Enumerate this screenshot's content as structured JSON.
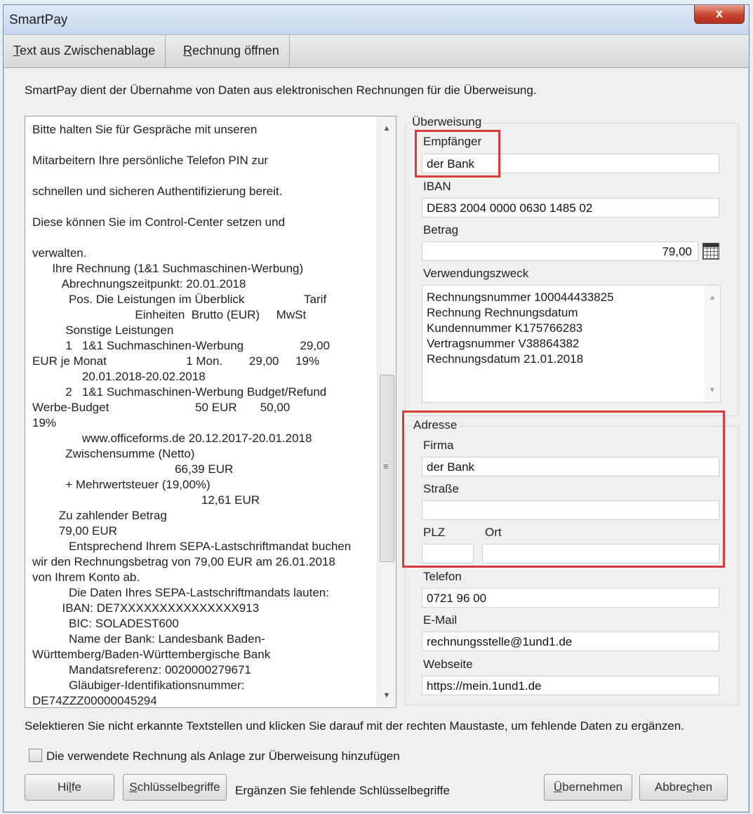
{
  "window": {
    "title": "SmartPay",
    "close_glyph": "x"
  },
  "toolbar": {
    "text_from_clipboard_access": "T",
    "text_from_clipboard_rest": "ext aus Zwischenablage",
    "open_invoice_access": "R",
    "open_invoice_rest": "echnung öffnen"
  },
  "intro": "SmartPay dient der Übernahme von Daten aus elektronischen Rechnungen für die Überweisung.",
  "invoice_text": "Bitte halten Sie für Gespräche mit unseren\n\nMitarbeitern Ihre persönliche Telefon PIN zur\n\nschnellen und sicheren Authentifizierung bereit.\n\nDiese können Sie im Control-Center setzen und\n\nverwalten.\n      Ihre Rechnung (1&1 Suchmaschinen-Werbung)\n         Abrechnungszeitpunkt: 20.01.2018\n           Pos. Die Leistungen im Überblick                  Tarif\n                               Einheiten  Brutto (EUR)     MwSt\n          Sonstige Leistungen\n          1   1&1 Suchmaschinen-Werbung                 29,00\nEUR je Monat                        1 Mon.        29,00     19%\n               20.01.2018-20.02.2018\n          2   1&1 Suchmaschinen-Werbung Budget/Refund\nWerbe-Budget                          50 EUR       50,00\n19%\n               www.officeforms.de 20.12.2017-20.01.2018\n          Zwischensumme (Netto)\n                                           66,39 EUR\n          + Mehrwertsteuer (19,00%)\n                                                   12,61 EUR\n        Zu zahlender Betrag\n        79,00 EUR\n           Entsprechend Ihrem SEPA-Lastschriftmandat buchen\nwir den Rechnungsbetrag von 79,00 EUR am 26.01.2018\nvon Ihrem Konto ab.\n           Die Daten Ihres SEPA-Lastschriftmandats lauten:\n         IBAN: DE7XXXXXXXXXXXXXXX913\n           BIC: SOLADEST600\n           Name der Bank: Landesbank Baden-\nWürttemberg/Baden-Württembergische Bank\n           Mandatsreferenz: 0020000279671\n           Gläubiger-Identifikationsnummer:\nDE74ZZZ00000045294",
  "transfer": {
    "group_label": "Überweisung",
    "recipient_label": "Empfänger",
    "recipient_value": "der Bank",
    "iban_label": "IBAN",
    "iban_value": "DE83 2004 0000 0630 1485 02",
    "amount_label": "Betrag",
    "amount_value": "79,00",
    "purpose_label": "Verwendungszweck",
    "purpose_value": "Rechnungsnummer 100044433825\nRechnung Rechnungsdatum\nKundennummer K175766283\nVertragsnummer V38864382\nRechnungsdatum 21.01.2018"
  },
  "address": {
    "group_label": "Adresse",
    "company_label": "Firma",
    "company_value": "der Bank",
    "street_label": "Straße",
    "street_value": "",
    "zip_label": "PLZ",
    "zip_value": "",
    "city_label": "Ort",
    "city_value": ""
  },
  "contact": {
    "phone_label": "Telefon",
    "phone_value": "0721 96 00",
    "email_label": "E-Mail",
    "email_value": "rechnungsstelle@1und1.de",
    "website_label": "Webseite",
    "website_value": "https://mein.1und1.de"
  },
  "hint": "Selektieren Sie nicht erkannte Textstellen und klicken Sie darauf mit der rechten Maustaste, um fehlende Daten zu ergänzen.",
  "attach_checkbox_label": "Die verwendete Rechnung als Anlage zur Überweisung hinzufügen",
  "buttons": {
    "help_pre": "Hi",
    "help_access": "l",
    "help_post": "fe",
    "keywords_access": "S",
    "keywords_rest": "chlüsselbegriffe",
    "keywords_hint": "Ergänzen Sie fehlende Schlüsselbegriffe",
    "apply_access": "Ü",
    "apply_rest": "bernehmen",
    "cancel_pre": "Abbre",
    "cancel_access": "c",
    "cancel_post": "hen"
  },
  "colors": {
    "highlight_box": "#d93a3a",
    "close_button": "#c8452e"
  }
}
